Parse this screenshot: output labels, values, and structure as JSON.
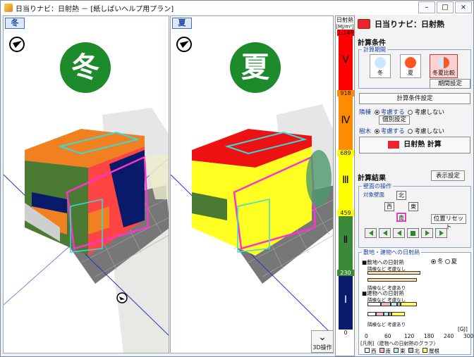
{
  "window": {
    "title": "日当りナビ：日射熱 － [紙しばいヘルプ用プラン]"
  },
  "panes": {
    "left": {
      "tab": "冬",
      "badge": "冬"
    },
    "right": {
      "tab": "夏",
      "badge": "夏"
    }
  },
  "scale": {
    "header": "日射熱",
    "unit": "[MJ/m²]",
    "ticks": [
      "1,148",
      "918",
      "689",
      "459",
      "230",
      "0"
    ],
    "bands": [
      "Ⅴ",
      "Ⅳ",
      "Ⅲ",
      "Ⅱ",
      "Ⅰ"
    ],
    "colors": [
      "#ff0000",
      "#ff8c00",
      "#ffff00",
      "#3a8a3a",
      "#0a1a6a"
    ]
  },
  "btn3d": "3D操作",
  "panel": {
    "header": "日当りナビ：日射熱",
    "calc_conditions": "計算条件",
    "period_label": "計算期間",
    "season_buttons": [
      {
        "label": "冬"
      },
      {
        "label": "夏"
      },
      {
        "label": "冬夏比較"
      }
    ],
    "period_setting": "期間設定",
    "calc_setting": "計算条件設定",
    "neighbor_label": "隣棟",
    "consider": "考慮する",
    "not_consider": "考慮しない",
    "individual": "個別設定",
    "trees_label": "樹木",
    "calc_button": "日射熱 計算",
    "results": "計算結果",
    "display_setting": "表示設定",
    "wall_ops": "壁面の操作",
    "target_wall": "対象壁面",
    "dirs": {
      "north": "北",
      "west": "西",
      "east": "東",
      "south": "南"
    },
    "reset": "位置リセット",
    "site_building": "敷地・建物への日射熱",
    "season_radio": {
      "winter": "冬",
      "summer": "夏"
    },
    "site_heat": "■敷地への日射熱",
    "building_heat": "■建物への日射熱",
    "neighbor_none": "隣棟など 考慮なし",
    "neighbor_yes": "隣棟など 考慮あり",
    "unit_gj": "[GJ]",
    "axis": [
      "0",
      "60",
      "120",
      "180",
      "240",
      "300"
    ],
    "legend_title": "[凡例]（建物への日射熱のグラフ）",
    "legend": [
      {
        "label": "西",
        "color": "#ffffff"
      },
      {
        "label": "南",
        "color": "#f4b6b6"
      },
      {
        "label": "東",
        "color": "#b7f0f0"
      },
      {
        "label": "北",
        "color": "#bbbbbb"
      },
      {
        "label": "屋根",
        "color": "#ffff66"
      }
    ],
    "site_bars": [
      {
        "value": 160,
        "color": "#f8dca8"
      },
      {
        "value": 150,
        "color": "#f8dca8"
      }
    ],
    "building_stack1": [
      {
        "value": 40,
        "color": "#ffffff"
      },
      {
        "value": 30,
        "color": "#f4b6b6"
      },
      {
        "value": 20,
        "color": "#b7f0f0"
      },
      {
        "value": 10,
        "color": "#bbbbbb"
      },
      {
        "value": 50,
        "color": "#ffff66"
      }
    ],
    "building_stack2": [
      {
        "value": 25,
        "color": "#ffffff"
      },
      {
        "value": 25,
        "color": "#f4b6b6"
      },
      {
        "value": 15,
        "color": "#b7f0f0"
      },
      {
        "value": 8,
        "color": "#bbbbbb"
      },
      {
        "value": 40,
        "color": "#ffff66"
      }
    ]
  }
}
